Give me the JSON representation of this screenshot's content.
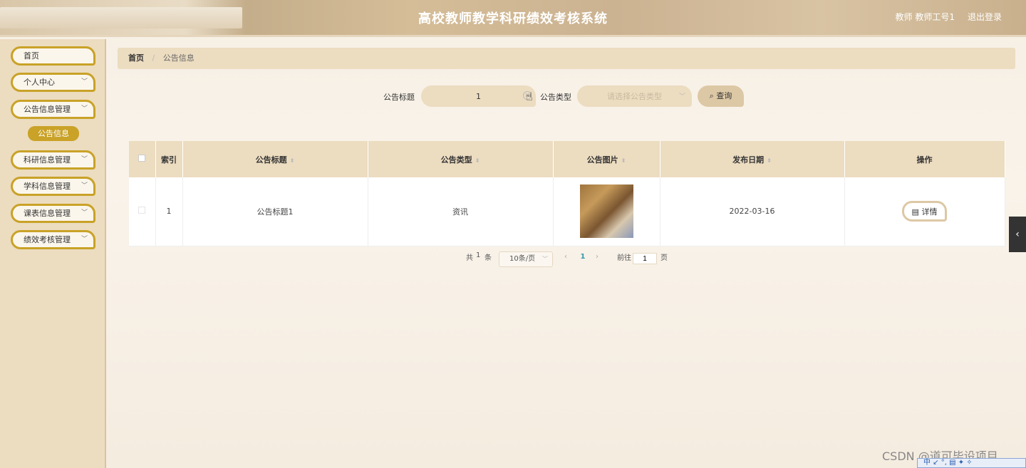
{
  "header": {
    "title": "高校教师教学科研绩效考核系统",
    "user": "教师 教师工号1",
    "logout": "退出登录"
  },
  "sidebar": {
    "items": [
      {
        "label": "首页",
        "chevron": false
      },
      {
        "label": "个人中心",
        "chevron": true
      },
      {
        "label": "公告信息管理",
        "chevron": true
      },
      {
        "label": "科研信息管理",
        "chevron": true
      },
      {
        "label": "学科信息管理",
        "chevron": true
      },
      {
        "label": "课表信息管理",
        "chevron": true
      },
      {
        "label": "绩效考核管理",
        "chevron": true
      }
    ],
    "active_sub": "公告信息"
  },
  "breadcrumb": {
    "home": "首页",
    "current": "公告信息"
  },
  "search": {
    "title_label": "公告标题",
    "title_value": "1",
    "type_label": "公告类型",
    "type_placeholder": "请选择公告类型",
    "query_label": "查询"
  },
  "table": {
    "headers": [
      "索引",
      "公告标题",
      "公告类型",
      "公告图片",
      "发布日期",
      "操作"
    ],
    "rows": [
      {
        "index": "1",
        "title": "公告标题1",
        "type": "资讯",
        "date": "2022-03-16",
        "action": "详情"
      }
    ]
  },
  "pagination": {
    "total_prefix": "共",
    "total": "1",
    "total_suffix": "条",
    "page_size": "10条/页",
    "current_page": "1",
    "goto_prefix": "前往",
    "goto_value": "1",
    "goto_suffix": "页"
  },
  "watermark": "CSDN @道可毕设项目",
  "ime_bar": "中 ↙ °, ▤ ✦ ✧",
  "icons": {
    "search": "search-icon",
    "detail": "document-icon",
    "chevron": "chevron-down-icon",
    "toggle": "chevron-left-icon"
  },
  "colors": {
    "accent": "#c9a227",
    "panel": "#ecdcc0",
    "link": "#3399aa"
  }
}
